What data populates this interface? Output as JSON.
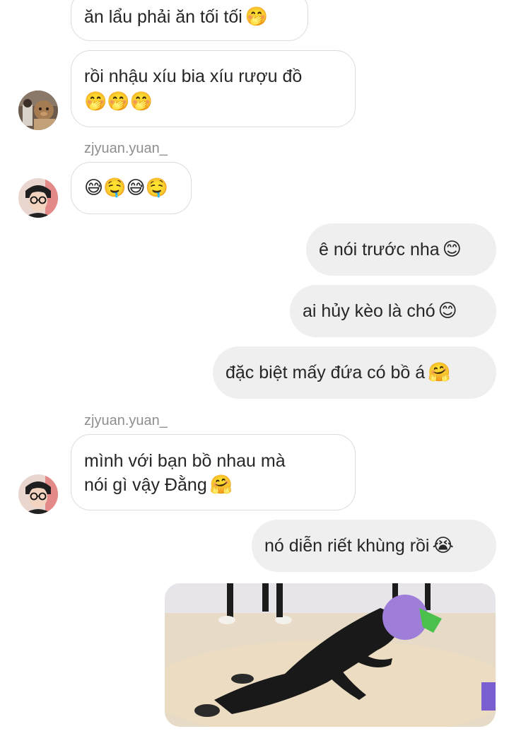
{
  "messages": {
    "m1": {
      "text": "ăn lẩu phải ăn tối tối",
      "emoji": "🤭"
    },
    "m2": {
      "line1": "rồi nhậu xíu bia xíu rượu đồ",
      "emoji": "🤭🤭🤭"
    },
    "sender1": "zjyuan.yuan_",
    "m3": {
      "emoji": "😅🤤😅🤤"
    },
    "m4": {
      "text": "ê nói trước nha",
      "emoji": "😊"
    },
    "m5": {
      "text": "ai hủy kèo là chó",
      "emoji": "😊"
    },
    "m6": {
      "text": "đặc biệt mấy đứa có bồ á",
      "emoji": "🤗"
    },
    "sender2": "zjyuan.yuan_",
    "m7": {
      "line1": "mình với bạn bồ nhau mà",
      "line2": "nói gì vậy Đằng",
      "emoji": "🤗"
    },
    "m8": {
      "text": "nó diễn riết khùng rồi",
      "emoji": "😭"
    }
  }
}
